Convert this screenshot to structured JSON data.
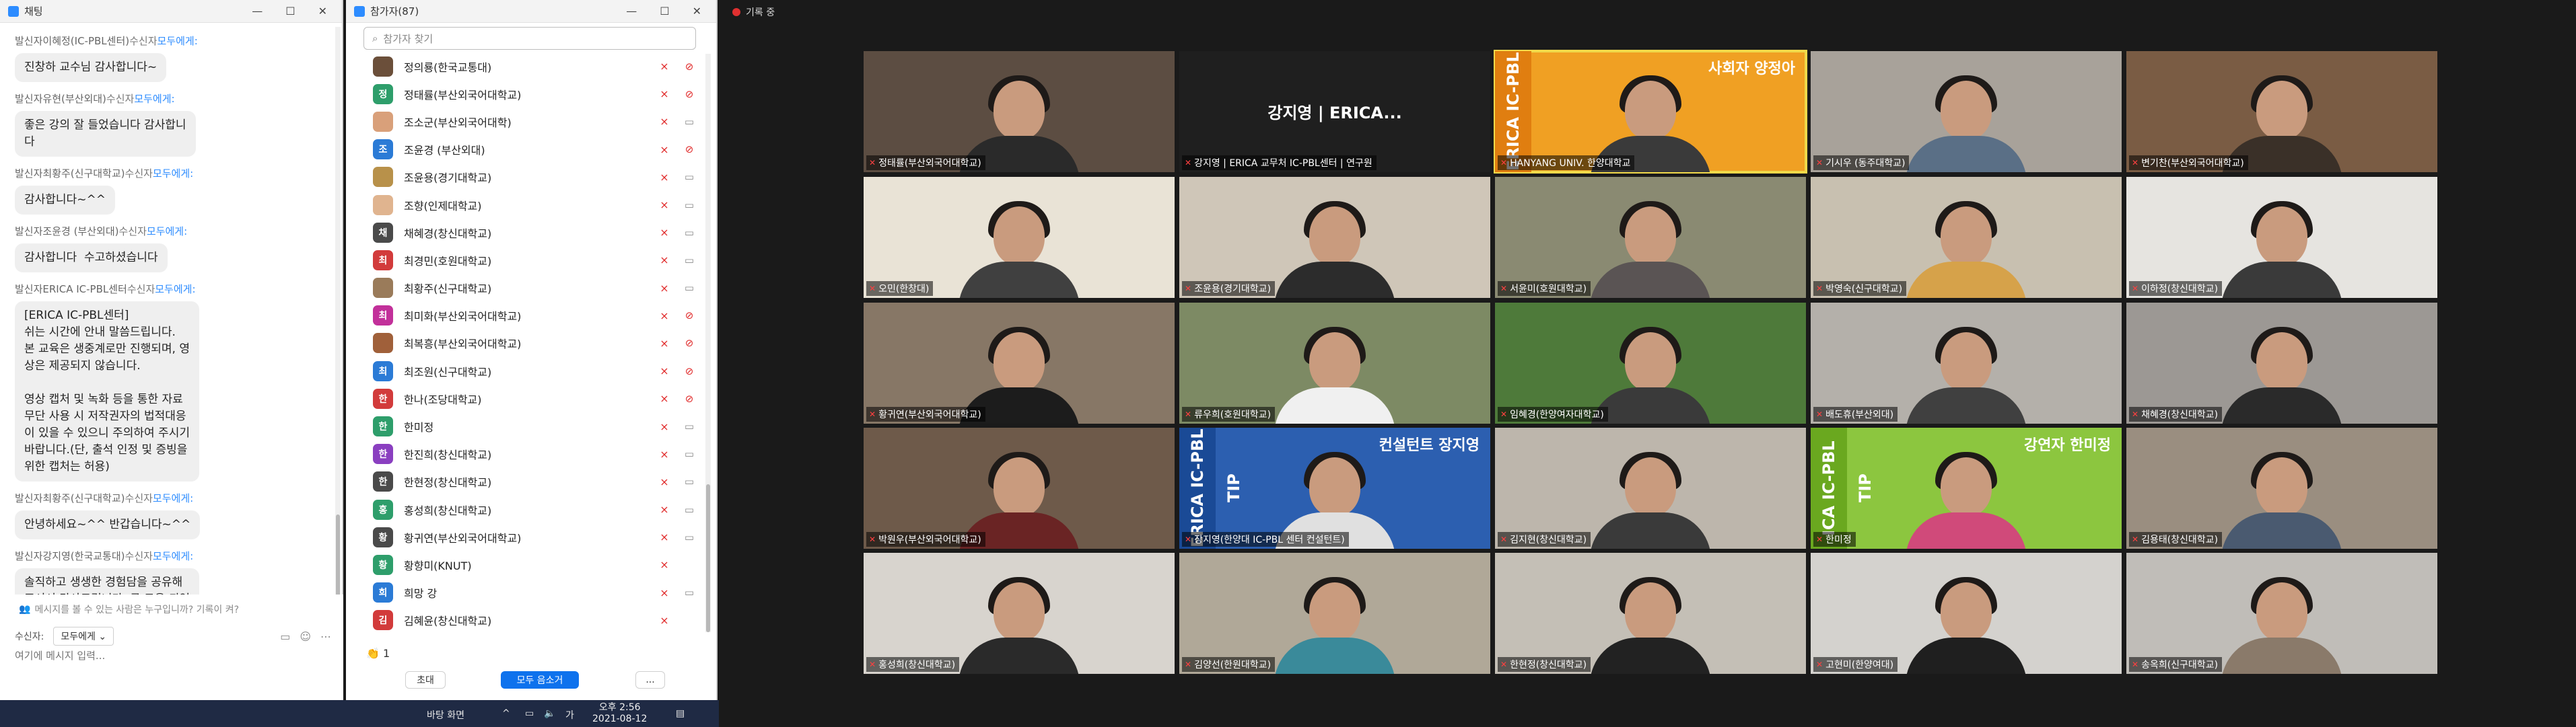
{
  "chat": {
    "title": "채팅",
    "messages": [
      {
        "sender": "발신자이혜정(IC-PBL센터)",
        "to_label": "수신자",
        "to": "모두에게:",
        "text": "진창하 교수님 감사합니다~"
      },
      {
        "sender": "발신자유현(부산외대)",
        "to_label": "수신자",
        "to": "모두에게:",
        "text": "좋은 강의 잘 들었습니다 감사합니\n다"
      },
      {
        "sender": "발신자최황주(신구대학교)",
        "to_label": "수신자",
        "to": "모두에게:",
        "text": "감사합니다~^^"
      },
      {
        "sender": "발신자조윤경 (부산외대)",
        "to_label": "수신자",
        "to": "모두에게:",
        "text": "감사합니다  수고하셨습니다"
      },
      {
        "sender": "발신자ERICA IC-PBL센터",
        "to_label": "수신자",
        "to": "모두에게:",
        "text": "[ERICA IC-PBL센터]\n쉬는 시간에 안내 말씀드립니다.\n본 교육은 생중계로만 진행되며, 영\n상은 제공되지 않습니다.\n\n영상 캡처 및 녹화 등을 통한 자료\n무단 사용 시 저작권자의 법적대응\n이 있을 수 있으니 주의하여 주시기\n바랍니다.(단, 출석 인정 및 증빙을\n위한 캡처는 허용)"
      },
      {
        "sender": "발신자최황주(신구대학교)",
        "to_label": "수신자",
        "to": "모두에게:",
        "text": "안녕하세요~^^ 반갑습니다~^^"
      },
      {
        "sender": "발신자강지영(한국교통대)",
        "to_label": "수신자",
        "to": "모두에게:",
        "text": "솔직하고 생생한 경험담을 공유해\n주셔서 감사드립니다. 큰 도움 되었\n습니다."
      }
    ],
    "notice": "메시지를 볼 수 있는 사람은 누구입니까? 기록이 켜?",
    "recipient_label": "수신자:",
    "recipient_value": "모두에게",
    "input_placeholder": "여기에 메시지 입력..."
  },
  "participants": {
    "title": "참가자(87)",
    "search_placeholder": "참가자 찾기",
    "list": [
      {
        "avatar": "",
        "color": "#6b4f3a",
        "name": "정의룡(한국교통대)",
        "cam": "off"
      },
      {
        "avatar": "정",
        "color": "#2e9e6b",
        "name": "정태률(부산외국어대학교)",
        "cam": "off"
      },
      {
        "avatar": "",
        "color": "#d9a07a",
        "name": "조소군(부산외국어대학)",
        "cam": "on"
      },
      {
        "avatar": "조",
        "color": "#2b7bd6",
        "name": "조윤경 (부산외대)",
        "cam": "off"
      },
      {
        "avatar": "",
        "color": "#b8914a",
        "name": "조윤용(경기대학교)",
        "cam": "on"
      },
      {
        "avatar": "",
        "color": "#e0b48f",
        "name": "조향(인제대학교)",
        "cam": "on"
      },
      {
        "avatar": "채",
        "color": "#4a4a4a",
        "name": "채혜경(창신대학교)",
        "cam": "on"
      },
      {
        "avatar": "최",
        "color": "#d23b3b",
        "name": "최경민(호원대학교)",
        "cam": "on"
      },
      {
        "avatar": "",
        "color": "#9a7b5a",
        "name": "최황주(신구대학교)",
        "cam": "on"
      },
      {
        "avatar": "최",
        "color": "#c2309a",
        "name": "최미화(부산외국어대학교)",
        "cam": "off"
      },
      {
        "avatar": "",
        "color": "#a0603a",
        "name": "최복흥(부산외국어대학교)",
        "cam": "off"
      },
      {
        "avatar": "최",
        "color": "#2b7bd6",
        "name": "최조원(신구대학교)",
        "cam": "off"
      },
      {
        "avatar": "한",
        "color": "#d23b3b",
        "name": "한나(조당대학교)",
        "cam": "off"
      },
      {
        "avatar": "한",
        "color": "#2e9e6b",
        "name": "한미정",
        "cam": "on"
      },
      {
        "avatar": "한",
        "color": "#8a3fc0",
        "name": "한진희(창신대학교)",
        "cam": "on"
      },
      {
        "avatar": "한",
        "color": "#4a4a4a",
        "name": "한현정(창신대학교)",
        "cam": "on"
      },
      {
        "avatar": "홍",
        "color": "#2e9e6b",
        "name": "홍성희(창신대학교)",
        "cam": "on"
      },
      {
        "avatar": "황",
        "color": "#4a4a4a",
        "name": "황귀연(부산외국어대학교)",
        "cam": "on"
      },
      {
        "avatar": "황",
        "color": "#2e9e6b",
        "name": "황향미(KNUT)",
        "cam": "none"
      },
      {
        "avatar": "희",
        "color": "#2b7bd6",
        "name": "희망 강",
        "cam": "on"
      },
      {
        "avatar": "김",
        "color": "#d23b3b",
        "name": "김혜윤(창신대학교)",
        "cam": "none"
      }
    ],
    "raise_hand_count": "1",
    "invite_label": "초대",
    "mute_all_label": "모두 음소거",
    "more_label": "..."
  },
  "meeting": {
    "title": "기록 중",
    "tiles": [
      {
        "name": "정태률(부산외국어대학교)",
        "bg": "#5c4d42",
        "body": "#2a2a2a",
        "kind": "video"
      },
      {
        "name": "강지영 | ERICA 교무처 IC-PBL센터 | 연구원",
        "bg": "#1f1f1f",
        "body": "#1f1f1f",
        "kind": "name",
        "center": "강지영 | ERICA..."
      },
      {
        "name": "HANYANG UNIV. 한양대학교",
        "bg": "#f0a023",
        "body": "#3a3a3a",
        "kind": "banner",
        "banner_top": "사회자  양정아",
        "banner_side": "ERICA IC-PBL",
        "banner_color": "#e07e10"
      },
      {
        "name": "기시우 (동주대학교)",
        "bg": "#a8a29a",
        "body": "#5a6f86",
        "kind": "video"
      },
      {
        "name": "변기찬(부산외국어대학교)",
        "bg": "#7a5c44",
        "body": "#3a3028",
        "kind": "video"
      },
      {
        "name": "오민(한창대)",
        "bg": "#e9e3d6",
        "body": "#404040",
        "kind": "video"
      },
      {
        "name": "조윤용(경기대학교)",
        "bg": "#cfc6b8",
        "body": "#2c2c2c",
        "kind": "video"
      },
      {
        "name": "서윤미(호원대학교)",
        "bg": "#8a8a72",
        "body": "#5a5454",
        "kind": "video"
      },
      {
        "name": "박영숙(신구대학교)",
        "bg": "#c8c0b0",
        "body": "#d6a24a",
        "kind": "video"
      },
      {
        "name": "이하정(창신대학교)",
        "bg": "#e6e4e0",
        "body": "#3a3a3a",
        "kind": "video"
      },
      {
        "name": "황귀연(부산외국어대학교)",
        "bg": "#877766",
        "body": "#1c1c1c",
        "kind": "video"
      },
      {
        "name": "류우희(호원대학교)",
        "bg": "#7d8a64",
        "body": "#f0f0f0",
        "kind": "video"
      },
      {
        "name": "임혜경(한양여자대학교)",
        "bg": "#4e7a3a",
        "body": "#3a3a3a",
        "kind": "video"
      },
      {
        "name": "배도휴(부산외대)",
        "bg": "#b4b0aa",
        "body": "#404040",
        "kind": "video"
      },
      {
        "name": "채혜경(창신대학교)",
        "bg": "#9c9894",
        "body": "#2a2a2a",
        "kind": "video"
      },
      {
        "name": "박원우(부산외국어대학교)",
        "bg": "#6e5a4a",
        "body": "#6a2424",
        "kind": "video"
      },
      {
        "name": "장지영(한양대 IC-PBL 센터 컨설턴트)",
        "bg": "#2c5fb0",
        "body": "#e0e0e0",
        "kind": "banner",
        "banner_top": "컨설턴트  장지영",
        "banner_side": "ERICA IC-PBL TIP",
        "banner_color": "#1a4a96"
      },
      {
        "name": "김지현(창신대학교)",
        "bg": "#bdb6ac",
        "body": "#3a3a3a",
        "kind": "video"
      },
      {
        "name": "한미정",
        "bg": "#8cc63f",
        "body": "#d04a7a",
        "kind": "banner",
        "banner_top": "강연자  한미정",
        "banner_side": "ICA IC-PBL TIP",
        "banner_color": "#6aa81f"
      },
      {
        "name": "김용태(창신대학교)",
        "bg": "#9a8e80",
        "body": "#4a5a70",
        "kind": "video"
      },
      {
        "name": "홍성희(창신대학교)",
        "bg": "#d8d4ce",
        "body": "#2a2a2a",
        "kind": "video"
      },
      {
        "name": "김양선(한원대학교)",
        "bg": "#b0a898",
        "body": "#3a8a9a",
        "kind": "video"
      },
      {
        "name": "한현정(창신대학교)",
        "bg": "#c4bfb6",
        "body": "#222222",
        "kind": "video"
      },
      {
        "name": "고현미(한양여대)",
        "bg": "#d4d2ce",
        "body": "#1f1f1f",
        "kind": "video"
      },
      {
        "name": "송옥희(신구대학교)",
        "bg": "#c0bdb8",
        "body": "#8a7a6a",
        "kind": "video"
      }
    ]
  },
  "taskbar": {
    "items": [
      "바탕 화면",
      "^",
      "가"
    ],
    "time": "오후 2:56",
    "date": "2021-08-12"
  }
}
